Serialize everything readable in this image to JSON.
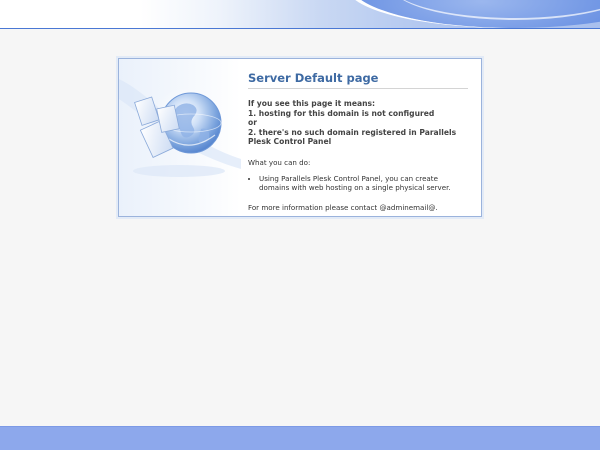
{
  "page": {
    "title": "Server Default page",
    "means_heading": "If you see this page it means:",
    "reasons": [
      "1. hosting for this domain is not configured",
      "or",
      "2. there's no such domain registered in Parallels",
      "Plesk Control Panel"
    ],
    "can_do_heading": "What you can do:",
    "bullets": [
      "Using Parallels Plesk Control Panel, you can create domains with web hosting on a single physical server."
    ],
    "more_info": "For more information please contact @adminemail@."
  },
  "icons": {
    "illustration": "globe-with-documents-icon"
  },
  "colors": {
    "title": "#3e6aa3",
    "banner_accent": "#3f6fd6",
    "bottom_band": "#8da8ec",
    "card_border": "#9bb3dc",
    "page_background": "#f6f6f6"
  }
}
